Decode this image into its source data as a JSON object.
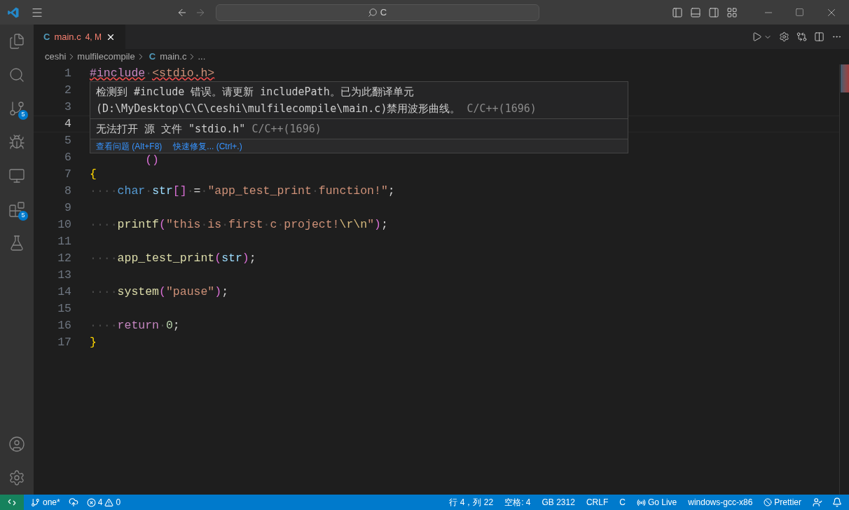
{
  "title_bar": {
    "search": {
      "value": "C"
    }
  },
  "activity_bar": {
    "items": [
      {
        "kind": "files",
        "selected": false
      },
      {
        "kind": "search",
        "selected": false
      },
      {
        "kind": "scm",
        "selected": false,
        "badge": "5"
      },
      {
        "kind": "debug",
        "selected": false
      },
      {
        "kind": "remote",
        "selected": false
      },
      {
        "kind": "extensions",
        "selected": false,
        "badge": "5"
      },
      {
        "kind": "testing",
        "selected": false
      }
    ]
  },
  "tabs": [
    {
      "icon": "C",
      "label": "main.c",
      "status": "4, M",
      "selected": true
    }
  ],
  "breadcrumbs": [
    {
      "kind": "folder",
      "label": "ceshi"
    },
    {
      "kind": "folder",
      "label": "mulfilecompile"
    },
    {
      "kind": "file",
      "icon": "C",
      "label": "main.c"
    },
    {
      "kind": "more",
      "label": "..."
    }
  ],
  "editor": {
    "lines": [
      {
        "number": "1",
        "current": false,
        "tokens": [
          {
            "kind": "directive",
            "text": "#include"
          },
          {
            "kind": "ws",
            "text": "·"
          },
          {
            "kind": "header",
            "text": "<stdio.h>"
          }
        ]
      },
      {
        "number": "2",
        "current": false
      },
      {
        "number": "3",
        "current": false
      },
      {
        "number": "4",
        "current": true
      },
      {
        "number": "5",
        "current": false
      },
      {
        "number": "6",
        "current": false,
        "tokens": [
          {
            "kind": "covered_bracket",
            "text": "()"
          }
        ]
      },
      {
        "number": "7",
        "current": false,
        "tokens": [
          {
            "kind": "brace",
            "text": "{"
          }
        ]
      },
      {
        "number": "8",
        "current": false,
        "tokens": [
          {
            "kind": "ws",
            "text": "····"
          },
          {
            "kind": "keyword",
            "text": "char"
          },
          {
            "kind": "ws",
            "text": "·"
          },
          {
            "kind": "variable",
            "text": "str"
          },
          {
            "kind": "bracket",
            "text": "[]"
          },
          {
            "kind": "ws",
            "text": "·"
          },
          {
            "kind": "plain",
            "text": "="
          },
          {
            "kind": "ws",
            "text": "·"
          },
          {
            "kind": "string",
            "text": "\"app_test_print"
          },
          {
            "kind": "ws",
            "text": "·"
          },
          {
            "kind": "string",
            "text": "function!\""
          },
          {
            "kind": "plain",
            "text": ";"
          }
        ]
      },
      {
        "number": "9",
        "current": false
      },
      {
        "number": "10",
        "current": false,
        "tokens": [
          {
            "kind": "ws",
            "text": "····"
          },
          {
            "kind": "function",
            "text": "printf"
          },
          {
            "kind": "bracket",
            "text": "("
          },
          {
            "kind": "string",
            "text": "\"this"
          },
          {
            "kind": "ws",
            "text": "·"
          },
          {
            "kind": "string",
            "text": "is"
          },
          {
            "kind": "ws",
            "text": "·"
          },
          {
            "kind": "string",
            "text": "first"
          },
          {
            "kind": "ws",
            "text": "·"
          },
          {
            "kind": "string",
            "text": "c"
          },
          {
            "kind": "ws",
            "text": "·"
          },
          {
            "kind": "string",
            "text": "project!"
          },
          {
            "kind": "escape",
            "text": "\\r\\n"
          },
          {
            "kind": "string",
            "text": "\""
          },
          {
            "kind": "bracket",
            "text": ")"
          },
          {
            "kind": "plain",
            "text": ";"
          }
        ]
      },
      {
        "number": "11",
        "current": false
      },
      {
        "number": "12",
        "current": false,
        "tokens": [
          {
            "kind": "ws",
            "text": "····"
          },
          {
            "kind": "function",
            "text": "app_test_print"
          },
          {
            "kind": "bracket",
            "text": "("
          },
          {
            "kind": "variable",
            "text": "str"
          },
          {
            "kind": "bracket",
            "text": ")"
          },
          {
            "kind": "plain",
            "text": ";"
          }
        ]
      },
      {
        "number": "13",
        "current": false
      },
      {
        "number": "14",
        "current": false,
        "tokens": [
          {
            "kind": "ws",
            "text": "····"
          },
          {
            "kind": "function",
            "text": "system"
          },
          {
            "kind": "bracket",
            "text": "("
          },
          {
            "kind": "string",
            "text": "\"pause\""
          },
          {
            "kind": "bracket",
            "text": ")"
          },
          {
            "kind": "plain",
            "text": ";"
          }
        ]
      },
      {
        "number": "15",
        "current": false
      },
      {
        "number": "16",
        "current": false,
        "tokens": [
          {
            "kind": "ws",
            "text": "····"
          },
          {
            "kind": "control",
            "text": "return"
          },
          {
            "kind": "ws",
            "text": "·"
          },
          {
            "kind": "number",
            "text": "0"
          },
          {
            "kind": "plain",
            "text": ";"
          }
        ]
      },
      {
        "number": "17",
        "current": false,
        "tokens": [
          {
            "kind": "brace",
            "text": "}"
          }
        ]
      }
    ]
  },
  "hover": {
    "messages": [
      {
        "text": "检测到 #include 错误。请更新 includePath。已为此翻译单元(D:\\MyDesktop\\C\\C\\ceshi\\mulfilecompile\\main.c)禁用波形曲线。",
        "source": "C/C++(1696)"
      },
      {
        "text": "无法打开 源 文件 \"stdio.h\"",
        "source": "C/C++(1696)"
      }
    ],
    "actions": [
      "查看问题 (Alt+F8)",
      "快速修复... (Ctrl+.)"
    ]
  },
  "status_bar": {
    "branch": "one*",
    "errors": "4",
    "warnings": "0",
    "right": [
      {
        "kind": "text",
        "label": "行 4，列 22"
      },
      {
        "kind": "text",
        "label": "空格: 4"
      },
      {
        "kind": "text",
        "label": "GB 2312"
      },
      {
        "kind": "text",
        "label": "CRLF"
      },
      {
        "kind": "text",
        "label": "C"
      },
      {
        "kind": "golive",
        "label": "Go Live"
      },
      {
        "kind": "text",
        "label": "windows-gcc-x86"
      },
      {
        "kind": "prettier",
        "label": "Prettier"
      }
    ]
  }
}
